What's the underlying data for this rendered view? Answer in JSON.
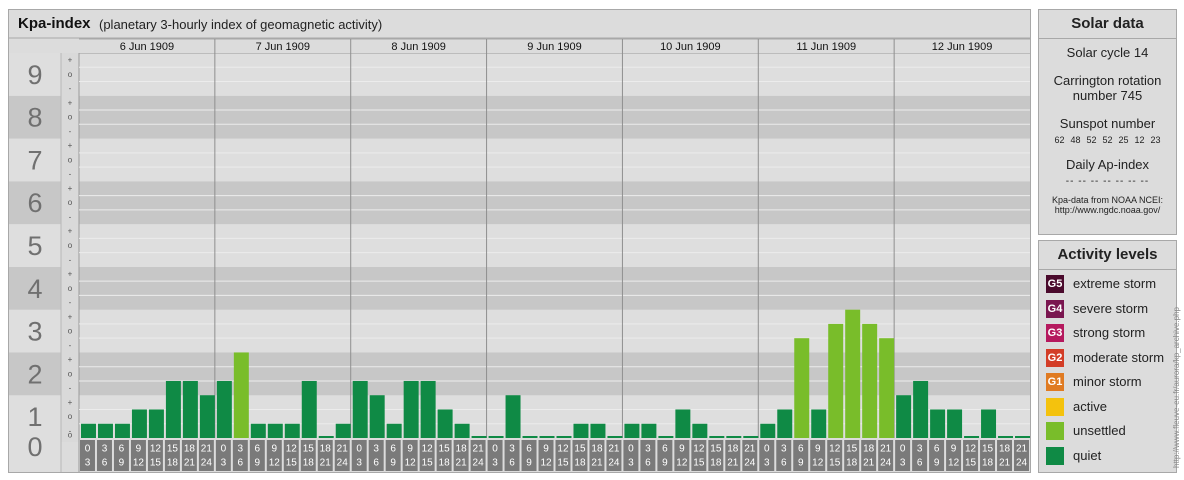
{
  "main": {
    "title": "Kpa-index",
    "subtitle": "(planetary 3-hourly index of geomagnetic activity)"
  },
  "chart_data": {
    "type": "bar",
    "title": "Kpa-index",
    "subtitle": "(planetary 3-hourly index of geomagnetic activity)",
    "ylim": [
      0,
      9
    ],
    "y_ticks": [
      "0",
      "1",
      "2",
      "3",
      "4",
      "5",
      "6",
      "7",
      "8",
      "9"
    ],
    "y_subticks": [
      "+",
      "o",
      "-"
    ],
    "days": [
      "6 Jun 1909",
      "7 Jun 1909",
      "8 Jun 1909",
      "9 Jun 1909",
      "10 Jun 1909",
      "11 Jun 1909",
      "12 Jun 1909"
    ],
    "hour_start": [
      "0",
      "3",
      "6",
      "9",
      "12",
      "15",
      "18",
      "21"
    ],
    "hour_end": [
      "3",
      "6",
      "9",
      "12",
      "15",
      "18",
      "21",
      "24"
    ],
    "values": [
      [
        0.333,
        0.333,
        0.333,
        0.667,
        0.667,
        1.333,
        1.333,
        1.0
      ],
      [
        1.333,
        2.0,
        0.333,
        0.333,
        0.333,
        1.333,
        0.0,
        0.333
      ],
      [
        1.333,
        1.0,
        0.333,
        1.333,
        1.333,
        0.667,
        0.333,
        0.0
      ],
      [
        0.0,
        1.0,
        0.0,
        0.0,
        0.0,
        0.333,
        0.333,
        0.0
      ],
      [
        0.333,
        0.333,
        0.0,
        0.667,
        0.333,
        0.0,
        0.0,
        0.0
      ],
      [
        0.333,
        0.667,
        2.333,
        0.667,
        2.667,
        3.0,
        2.667,
        2.333
      ],
      [
        1.0,
        1.333,
        0.667,
        0.667,
        0.0,
        0.667,
        0.0,
        0.0
      ]
    ],
    "colors": {
      "quiet": "#0f8a45",
      "unsettled": "#79bd2a",
      "active": "#f4c20d",
      "minor": "#e07b22",
      "moderate": "#d33d27",
      "strong": "#b5195e",
      "severe": "#7a1650",
      "extreme": "#4a0a2c"
    }
  },
  "solar": {
    "title": "Solar data",
    "cycle": "Solar cycle 14",
    "carrington_line1": "Carrington rotation",
    "carrington_line2": "number 745",
    "sunspot_label": "Sunspot number",
    "sunspot_values": [
      "62",
      "48",
      "52",
      "52",
      "25",
      "12",
      "23"
    ],
    "ap_label": "Daily Ap-index",
    "ap_values": [
      "--",
      "--",
      "--",
      "--",
      "--",
      "--",
      "--"
    ],
    "source_line1": "Kpa-data from NOAA NCEI:",
    "source_line2": "http://www.ngdc.noaa.gov/"
  },
  "activity": {
    "title": "Activity levels",
    "levels": [
      {
        "badge": "G5",
        "label": "extreme storm",
        "color": "#4a0a2c"
      },
      {
        "badge": "G4",
        "label": "severe storm",
        "color": "#7a1650"
      },
      {
        "badge": "G3",
        "label": "strong storm",
        "color": "#b5195e"
      },
      {
        "badge": "G2",
        "label": "moderate storm",
        "color": "#d33d27"
      },
      {
        "badge": "G1",
        "label": "minor storm",
        "color": "#e07b22"
      },
      {
        "badge": "",
        "label": "active",
        "color": "#f4c20d"
      },
      {
        "badge": "",
        "label": "unsettled",
        "color": "#79bd2a"
      },
      {
        "badge": "",
        "label": "quiet",
        "color": "#0f8a45"
      }
    ]
  },
  "watermark": "http://www.fleuve-eu.fr/aurora/kp_archive.php"
}
